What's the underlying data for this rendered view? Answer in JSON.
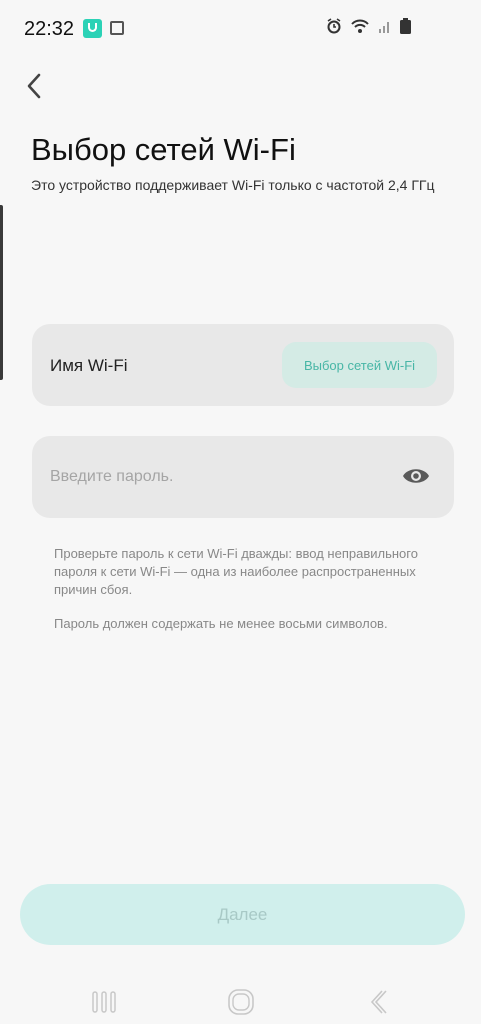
{
  "status_bar": {
    "time": "22:32"
  },
  "page": {
    "title": "Выбор сетей Wi-Fi",
    "subtitle": "Это устройство поддерживает Wi-Fi только с частотой 2,4 ГГц"
  },
  "wifi_card": {
    "label": "Имя Wi-Fi",
    "select_button": "Выбор сетей Wi-Fi"
  },
  "password_card": {
    "placeholder": "Введите пароль.",
    "value": ""
  },
  "help": {
    "tip": "Проверьте пароль к сети Wi-Fi дважды: ввод неправильного пароля к сети Wi-Fi — одна из наиболее распространенных причин сбоя.",
    "rule": "Пароль должен содержать не менее восьми символов."
  },
  "footer": {
    "next_button": "Далее"
  },
  "colors": {
    "accent": "#48b6a6",
    "accent_light": "#d4ebe5",
    "next_button_bg": "#d0efec"
  },
  "icons": [
    "back-icon",
    "eye-icon",
    "alarm-icon",
    "wifi-icon",
    "signal-icon",
    "battery-icon",
    "recent-apps-icon",
    "home-icon",
    "nav-back-icon"
  ]
}
